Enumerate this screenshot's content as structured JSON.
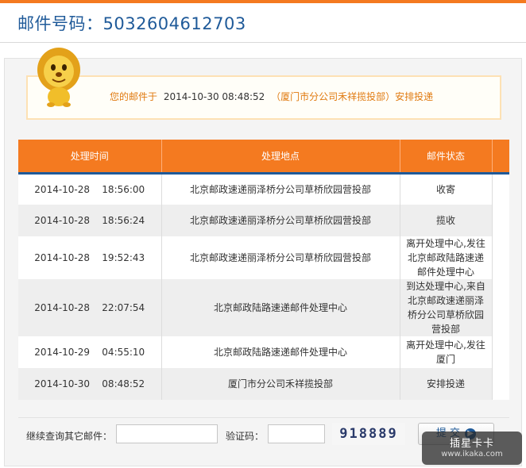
{
  "header": {
    "title": "邮件号码：5032604612703"
  },
  "notice": {
    "prefix": "您的邮件于",
    "datetime": "2014-10-30 08:48:52",
    "suffix": "（厦门市分公司禾祥揽投部）安排投递"
  },
  "table": {
    "headers": [
      "处理时间",
      "处理地点",
      "邮件状态"
    ],
    "rows": [
      {
        "time": "2014-10-28    18:56:00",
        "place": "北京邮政速递丽泽桥分公司草桥欣园营投部",
        "status": "收寄"
      },
      {
        "time": "2014-10-28    18:56:24",
        "place": "北京邮政速递丽泽桥分公司草桥欣园营投部",
        "status": "揽收"
      },
      {
        "time": "2014-10-28    19:52:43",
        "place": "北京邮政速递丽泽桥分公司草桥欣园营投部",
        "status": "离开处理中心,发往北京邮政陆路速递邮件处理中心"
      },
      {
        "time": "2014-10-28    22:07:54",
        "place": "北京邮政陆路速递邮件处理中心",
        "status": "到达处理中心,来自北京邮政速递丽泽桥分公司草桥欣园营投部"
      },
      {
        "time": "2014-10-29    04:55:10",
        "place": "北京邮政陆路速递邮件处理中心",
        "status": "离开处理中心,发往厦门"
      },
      {
        "time": "2014-10-30    08:48:52",
        "place": "厦门市分公司禾祥揽投部",
        "status": "安排投递"
      }
    ]
  },
  "search": {
    "query_label": "继续查询其它邮件：",
    "query_value": "",
    "captcha_label": "验证码：",
    "captcha_value": "",
    "captcha_text": "918889",
    "submit_label": "提 交"
  },
  "watermark": {
    "line1": "插星卡卡",
    "line2": "www.ikaka.com"
  },
  "colors": {
    "accent": "#f47a20",
    "brand": "#1f5a99"
  }
}
